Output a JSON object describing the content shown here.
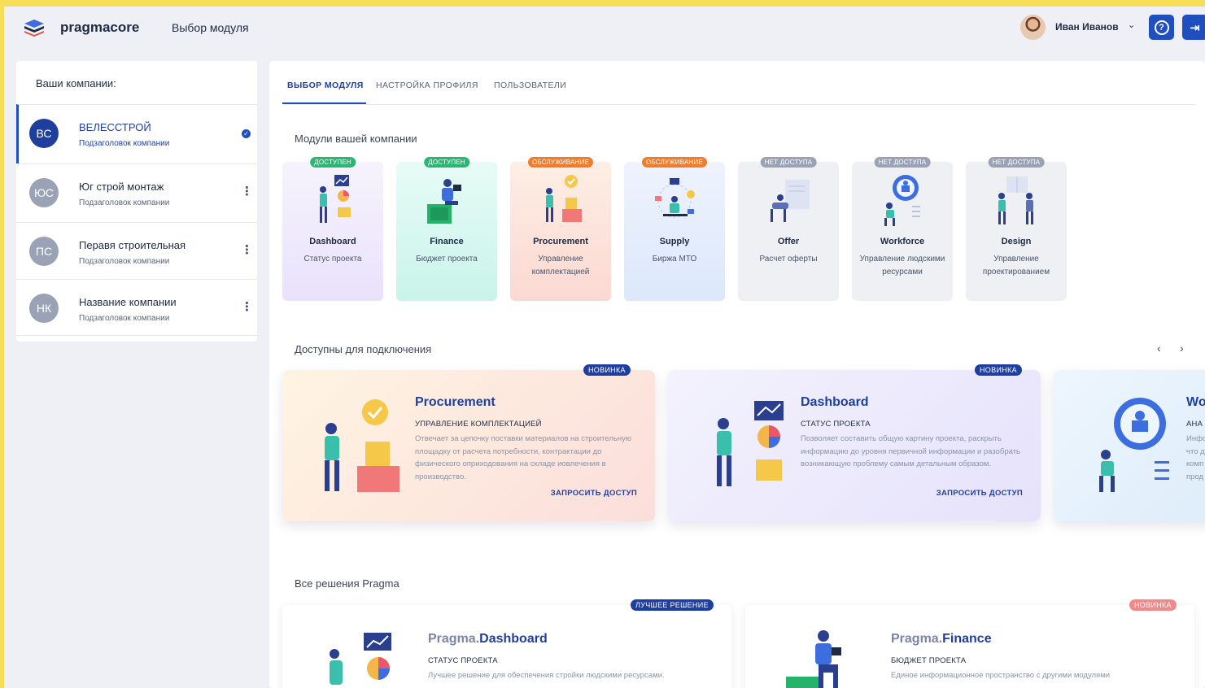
{
  "header": {
    "logo_text": "pragmacore",
    "page_title": "Выбор модуля",
    "user_name": "Иван Иванов",
    "help_label": "?",
    "exit_label": "⇥"
  },
  "sidebar": {
    "title": "Ваши компании:",
    "companies": [
      {
        "initials": "ВС",
        "name": "ВЕЛЕССТРОЙ",
        "subtitle": "Подзаголовок компании",
        "color": "#1f3f9f"
      },
      {
        "initials": "ЮС",
        "name": "Юг строй монтаж",
        "subtitle": "Подзаголовок компании",
        "color": "#9aa3b5"
      },
      {
        "initials": "ПС",
        "name": "Перавя строительная",
        "subtitle": "Подзаголовок компании",
        "color": "#9aa3b5"
      },
      {
        "initials": "НК",
        "name": "Название компании",
        "subtitle": "Подзаголовок компании",
        "color": "#9aa3b5"
      }
    ]
  },
  "tabs": [
    {
      "label": "ВЫБОР МОДУЛЯ"
    },
    {
      "label": "НАСТРОЙКА ПРОФИЛЯ"
    },
    {
      "label": "ПОЛЬЗОВАТЕЛИ"
    }
  ],
  "sections": {
    "company_modules": "Модули вашей компании",
    "available": "Доступны для подключения",
    "all_solutions": "Все решения Pragma"
  },
  "modules": [
    {
      "badge": "ДОСТУПЕН",
      "name": "Dashboard",
      "desc": "Статус проекта"
    },
    {
      "badge": "ДОСТУПЕН",
      "name": "Finance",
      "desc": "Бюджет проекта"
    },
    {
      "badge": "ОБСЛУЖИВАНИЕ",
      "name": "Procurement",
      "desc": "Управление комплектацией"
    },
    {
      "badge": "ОБСЛУЖИВАНИЕ",
      "name": "Supply",
      "desc": "Биржа МТО"
    },
    {
      "badge": "НЕТ ДОСТУПА",
      "name": "Offer",
      "desc": "Расчет оферты"
    },
    {
      "badge": "НЕТ ДОСТУПА",
      "name": "Workforce",
      "desc": "Управление людскими ресурсами"
    },
    {
      "badge": "НЕТ ДОСТУПА",
      "name": "Design",
      "desc": "Управление проектированием"
    }
  ],
  "promos": [
    {
      "badge": "НОВИНКА",
      "title": "Procurement",
      "subtitle": "УПРАВЛЕНИЕ КОМПЛЕКТАЦИЕЙ",
      "desc": "Отвечает за цепочку поставки материалов на строительную площадку от расчета потребности, контрактации до физического оприходования на складе иовлечения в производство.",
      "action": "ЗАПРОСИТЬ ДОСТУП"
    },
    {
      "badge": "НОВИНКА",
      "title": "Dashboard",
      "subtitle": "СТАТУС ПРОЕКТА",
      "desc": "Позволяет составить общую картину проекта, раскрыть информацию до уровня первичной информации и разобрать возникающую проблему самым детальным образом.",
      "action": "ЗАПРОСИТЬ ДОСТУП"
    },
    {
      "badge": "",
      "title": "Wo",
      "subtitle": "АНА",
      "desc": "Инфо что д комп прод",
      "action": ""
    }
  ],
  "carousel": {
    "prev": "‹",
    "next": "›"
  },
  "solutions": [
    {
      "badge": "ЛУЧШЕЕ РЕШЕНИЕ",
      "prefix": "Pragma.",
      "name": "Dashboard",
      "subtitle": "СТАТУС ПРОЕКТА",
      "desc": "Лучшее решение для обеспечения стройки людскими ресурсами."
    },
    {
      "badge": "НОВИНКА",
      "prefix": "Pragma.",
      "name": "Finance",
      "subtitle": "БЮДЖЕТ ПРОЕКТА",
      "desc": "Единое информационное пространство с другими модулями"
    }
  ],
  "colors": {
    "accent": "#1f4fbf",
    "badge_available": "#2bb673",
    "badge_service": "#f07c2c",
    "badge_noaccess": "#9aa3b5",
    "badge_new": "#1f3f9f",
    "badge_new_soft": "#f08a8a"
  }
}
